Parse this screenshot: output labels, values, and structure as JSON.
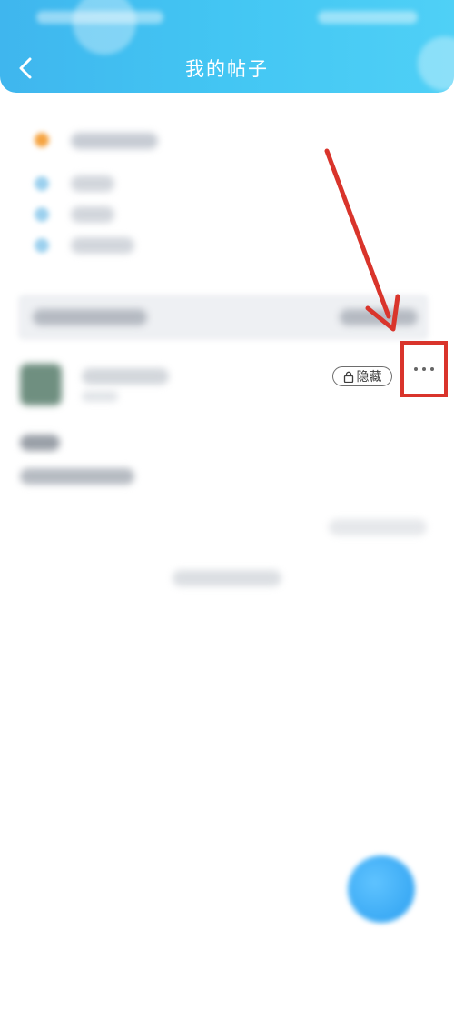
{
  "header": {
    "title": "我的帖子",
    "back_icon": "chevron-left-icon",
    "background_color": "#43c6f3"
  },
  "post": {
    "hidden_badge": {
      "icon": "lock-icon",
      "label": "隐藏"
    },
    "more_icon": "more-dots-icon"
  },
  "annotation": {
    "color": "#d9342b"
  }
}
